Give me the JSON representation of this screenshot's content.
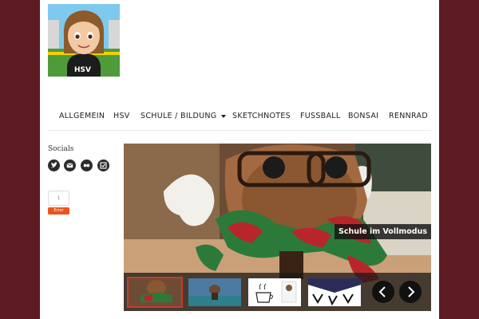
{
  "nav": {
    "items": [
      {
        "label": "ALLGEMEIN"
      },
      {
        "label": "HSV"
      },
      {
        "label": "SCHULE / BILDUNG",
        "has_dropdown": true
      },
      {
        "label": "SKETCHNOTES"
      },
      {
        "label": "FUSSBALL"
      },
      {
        "label": "BONSAI"
      },
      {
        "label": "RENNRAD"
      }
    ]
  },
  "logo": {
    "jersey_text": "HSV"
  },
  "sidebar": {
    "socials_title": "Socials",
    "icons": [
      "twitter-icon",
      "email-icon",
      "flickr-icon",
      "delicious-icon"
    ],
    "counter_value": "1",
    "counter_button": "Error"
  },
  "slider": {
    "caption": "Schule im Vollmodus",
    "thumbnails": [
      "thumb-figure-scarf",
      "thumb-figure-desk",
      "thumb-coffee-sketch",
      "thumb-dark-sketch"
    ]
  },
  "colors": {
    "background": "#5e1b22",
    "page": "#ffffff",
    "accent_button": "#e8551f"
  }
}
